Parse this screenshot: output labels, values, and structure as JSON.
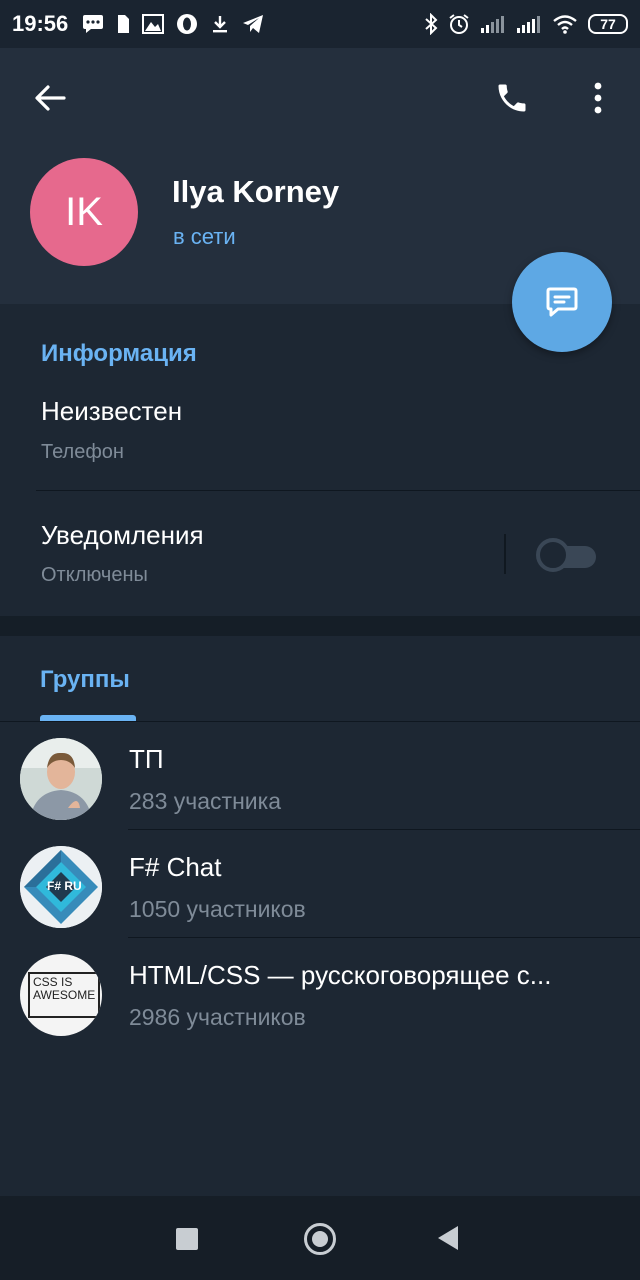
{
  "status_bar": {
    "time": "19:56",
    "battery": "77",
    "left_icons": [
      "message-icon",
      "sim-icon",
      "photo-icon",
      "opera-icon",
      "download-icon",
      "telegram-icon"
    ],
    "right_icons": [
      "bluetooth-icon",
      "alarm-icon",
      "signal-icon",
      "signal-icon",
      "wifi-icon",
      "battery-icon"
    ]
  },
  "header": {
    "avatar_initials": "IK",
    "avatar_color": "#e6698d",
    "name": "Ilya Korney",
    "status": "в сети"
  },
  "info": {
    "section_title": "Информация",
    "phone_value": "Неизвестен",
    "phone_label": "Телефон",
    "notifications_title": "Уведомления",
    "notifications_status": "Отключены",
    "notifications_enabled": false
  },
  "groups": {
    "tab_label": "Группы",
    "items": [
      {
        "name": "ТП",
        "members": "283 участника",
        "avatar": "photo-avatar"
      },
      {
        "name": "F# Chat",
        "members": "1050 участников",
        "avatar": "fsharp-logo",
        "logo_text": "F# RU"
      },
      {
        "name": "HTML/CSS — русскоговорящее с...",
        "members": "2986 участников",
        "avatar": "css-is-awesome-logo",
        "logo_text": "CSS IS AWESOME"
      }
    ]
  },
  "colors": {
    "accent": "#6ab3f3",
    "fab": "#5ea8e4",
    "header_bg": "#242f3d",
    "body_bg": "#1d2733"
  }
}
